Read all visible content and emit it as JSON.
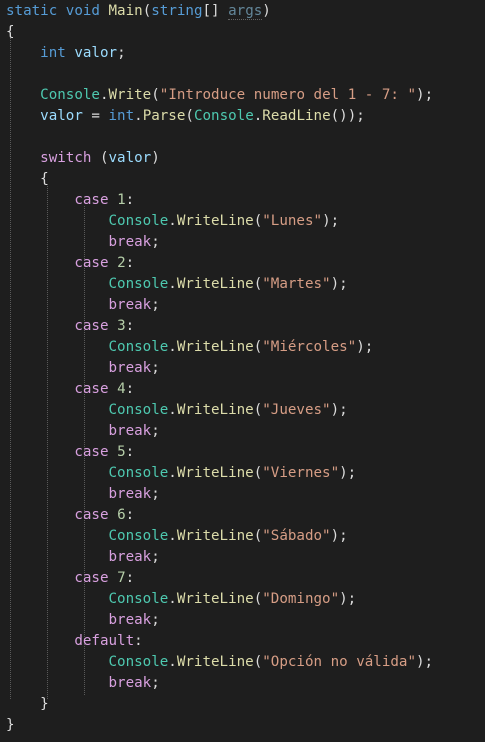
{
  "colors": {
    "background": "#1e1e1e",
    "keyword": "#569cd6",
    "control_keyword": "#d8a0df",
    "type_name": "#4ec9b0",
    "method_name": "#dcdcaa",
    "string_literal": "#d69d85",
    "number_literal": "#b5cea8",
    "variable": "#9cdcfe",
    "plain_text": "#dcdcdc"
  },
  "code": {
    "lines": [
      [
        [
          "kw",
          "static"
        ],
        [
          "p",
          " "
        ],
        [
          "kw",
          "void"
        ],
        [
          "p",
          " "
        ],
        [
          "meth",
          "Main"
        ],
        [
          "p",
          "("
        ],
        [
          "kw",
          "string"
        ],
        [
          "p",
          "[] "
        ],
        [
          "unused",
          "args"
        ],
        [
          "p",
          ")"
        ]
      ],
      [
        [
          "p",
          "{"
        ]
      ],
      [
        [
          "p",
          "    "
        ],
        [
          "kw",
          "int"
        ],
        [
          "p",
          " "
        ],
        [
          "var",
          "valor"
        ],
        [
          "p",
          ";"
        ]
      ],
      [],
      [
        [
          "p",
          "    "
        ],
        [
          "type",
          "Console"
        ],
        [
          "p",
          "."
        ],
        [
          "meth",
          "Write"
        ],
        [
          "p",
          "("
        ],
        [
          "str",
          "\"Introduce numero del 1 - 7: \""
        ],
        [
          "p",
          ");"
        ]
      ],
      [
        [
          "p",
          "    "
        ],
        [
          "var",
          "valor"
        ],
        [
          "p",
          " = "
        ],
        [
          "kw",
          "int"
        ],
        [
          "p",
          "."
        ],
        [
          "meth",
          "Parse"
        ],
        [
          "p",
          "("
        ],
        [
          "type",
          "Console"
        ],
        [
          "p",
          "."
        ],
        [
          "meth",
          "ReadLine"
        ],
        [
          "p",
          "());"
        ]
      ],
      [],
      [
        [
          "p",
          "    "
        ],
        [
          "ctl",
          "switch"
        ],
        [
          "p",
          " ("
        ],
        [
          "var",
          "valor"
        ],
        [
          "p",
          ")"
        ]
      ],
      [
        [
          "p",
          "    {"
        ]
      ],
      [
        [
          "p",
          "        "
        ],
        [
          "ctl",
          "case"
        ],
        [
          "p",
          " "
        ],
        [
          "num",
          "1"
        ],
        [
          "p",
          ":"
        ]
      ],
      [
        [
          "p",
          "            "
        ],
        [
          "type",
          "Console"
        ],
        [
          "p",
          "."
        ],
        [
          "meth",
          "WriteLine"
        ],
        [
          "p",
          "("
        ],
        [
          "str",
          "\"Lunes\""
        ],
        [
          "p",
          ");"
        ]
      ],
      [
        [
          "p",
          "            "
        ],
        [
          "ctl",
          "break"
        ],
        [
          "p",
          ";"
        ]
      ],
      [
        [
          "p",
          "        "
        ],
        [
          "ctl",
          "case"
        ],
        [
          "p",
          " "
        ],
        [
          "num",
          "2"
        ],
        [
          "p",
          ":"
        ]
      ],
      [
        [
          "p",
          "            "
        ],
        [
          "type",
          "Console"
        ],
        [
          "p",
          "."
        ],
        [
          "meth",
          "WriteLine"
        ],
        [
          "p",
          "("
        ],
        [
          "str",
          "\"Martes\""
        ],
        [
          "p",
          ");"
        ]
      ],
      [
        [
          "p",
          "            "
        ],
        [
          "ctl",
          "break"
        ],
        [
          "p",
          ";"
        ]
      ],
      [
        [
          "p",
          "        "
        ],
        [
          "ctl",
          "case"
        ],
        [
          "p",
          " "
        ],
        [
          "num",
          "3"
        ],
        [
          "p",
          ":"
        ]
      ],
      [
        [
          "p",
          "            "
        ],
        [
          "type",
          "Console"
        ],
        [
          "p",
          "."
        ],
        [
          "meth",
          "WriteLine"
        ],
        [
          "p",
          "("
        ],
        [
          "str",
          "\"Miércoles\""
        ],
        [
          "p",
          ");"
        ]
      ],
      [
        [
          "p",
          "            "
        ],
        [
          "ctl",
          "break"
        ],
        [
          "p",
          ";"
        ]
      ],
      [
        [
          "p",
          "        "
        ],
        [
          "ctl",
          "case"
        ],
        [
          "p",
          " "
        ],
        [
          "num",
          "4"
        ],
        [
          "p",
          ":"
        ]
      ],
      [
        [
          "p",
          "            "
        ],
        [
          "type",
          "Console"
        ],
        [
          "p",
          "."
        ],
        [
          "meth",
          "WriteLine"
        ],
        [
          "p",
          "("
        ],
        [
          "str",
          "\"Jueves\""
        ],
        [
          "p",
          ");"
        ]
      ],
      [
        [
          "p",
          "            "
        ],
        [
          "ctl",
          "break"
        ],
        [
          "p",
          ";"
        ]
      ],
      [
        [
          "p",
          "        "
        ],
        [
          "ctl",
          "case"
        ],
        [
          "p",
          " "
        ],
        [
          "num",
          "5"
        ],
        [
          "p",
          ":"
        ]
      ],
      [
        [
          "p",
          "            "
        ],
        [
          "type",
          "Console"
        ],
        [
          "p",
          "."
        ],
        [
          "meth",
          "WriteLine"
        ],
        [
          "p",
          "("
        ],
        [
          "str",
          "\"Viernes\""
        ],
        [
          "p",
          ");"
        ]
      ],
      [
        [
          "p",
          "            "
        ],
        [
          "ctl",
          "break"
        ],
        [
          "p",
          ";"
        ]
      ],
      [
        [
          "p",
          "        "
        ],
        [
          "ctl",
          "case"
        ],
        [
          "p",
          " "
        ],
        [
          "num",
          "6"
        ],
        [
          "p",
          ":"
        ]
      ],
      [
        [
          "p",
          "            "
        ],
        [
          "type",
          "Console"
        ],
        [
          "p",
          "."
        ],
        [
          "meth",
          "WriteLine"
        ],
        [
          "p",
          "("
        ],
        [
          "str",
          "\"Sábado\""
        ],
        [
          "p",
          ");"
        ]
      ],
      [
        [
          "p",
          "            "
        ],
        [
          "ctl",
          "break"
        ],
        [
          "p",
          ";"
        ]
      ],
      [
        [
          "p",
          "        "
        ],
        [
          "ctl",
          "case"
        ],
        [
          "p",
          " "
        ],
        [
          "num",
          "7"
        ],
        [
          "p",
          ":"
        ]
      ],
      [
        [
          "p",
          "            "
        ],
        [
          "type",
          "Console"
        ],
        [
          "p",
          "."
        ],
        [
          "meth",
          "WriteLine"
        ],
        [
          "p",
          "("
        ],
        [
          "str",
          "\"Domingo\""
        ],
        [
          "p",
          ");"
        ]
      ],
      [
        [
          "p",
          "            "
        ],
        [
          "ctl",
          "break"
        ],
        [
          "p",
          ";"
        ]
      ],
      [
        [
          "p",
          "        "
        ],
        [
          "ctl",
          "default"
        ],
        [
          "p",
          ":"
        ]
      ],
      [
        [
          "p",
          "            "
        ],
        [
          "type",
          "Console"
        ],
        [
          "p",
          "."
        ],
        [
          "meth",
          "WriteLine"
        ],
        [
          "p",
          "("
        ],
        [
          "str",
          "\"Opción no válida\""
        ],
        [
          "p",
          ");"
        ]
      ],
      [
        [
          "p",
          "            "
        ],
        [
          "ctl",
          "break"
        ],
        [
          "p",
          ";"
        ]
      ],
      [
        [
          "p",
          "    }"
        ]
      ],
      [
        [
          "p",
          "}"
        ]
      ]
    ]
  }
}
